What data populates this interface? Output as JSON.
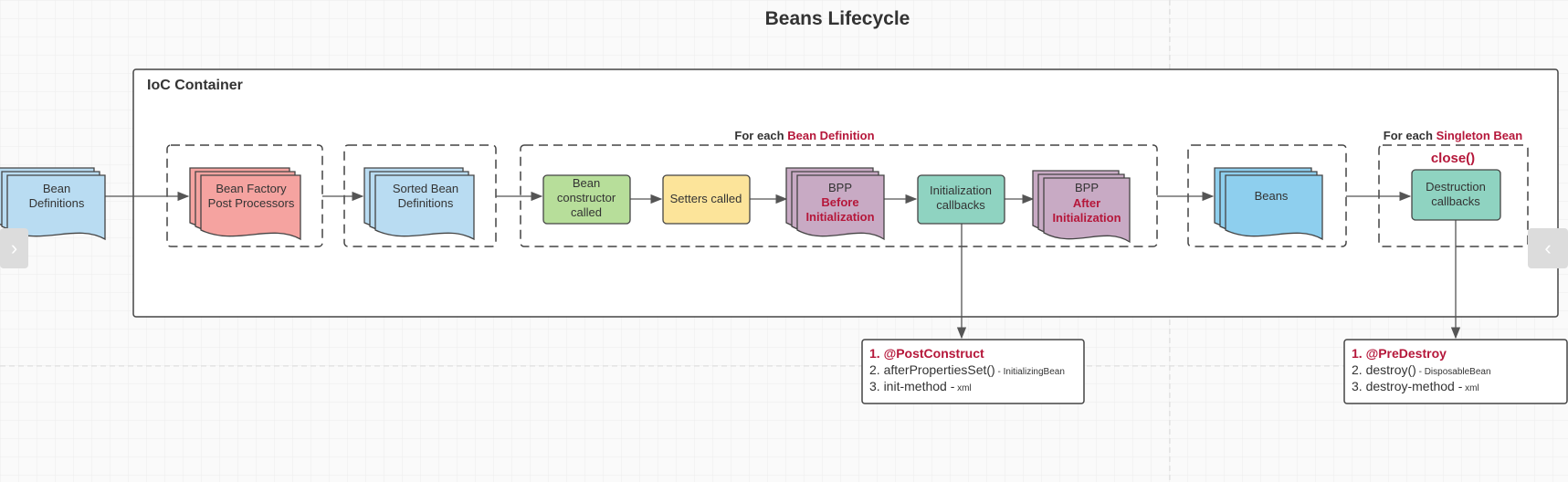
{
  "title": "Beans Lifecycle",
  "container": {
    "label": "IoC Container"
  },
  "colors": {
    "accent_red": "#b5173a",
    "bean_def_blue": "#b9dcf2",
    "bfpp_red": "#f5a3a0",
    "bpp_purple": "#c8aac4",
    "constructor_green": "#b7de9a",
    "setters_yellow": "#fce49a",
    "callbacks_teal": "#8fd3c1",
    "beans_blue": "#8ecfee"
  },
  "nodes": {
    "bean_definitions": [
      "Bean",
      "Definitions"
    ],
    "bfpp": [
      "Bean Factory",
      "Post Processors"
    ],
    "sorted": [
      "Sorted Bean",
      "Definitions"
    ],
    "constructor": [
      "Bean",
      "constructor",
      "called"
    ],
    "setters": "Setters called",
    "bpp_before": [
      "BPP",
      "Before",
      "Initialization"
    ],
    "init_callbacks": [
      "Initialization",
      "callbacks"
    ],
    "bpp_after": [
      "BPP",
      "After",
      "Initialization"
    ],
    "beans": "Beans",
    "destruction": [
      "Destruction",
      "callbacks"
    ]
  },
  "groups": {
    "for_each_def": {
      "prefix": "For each ",
      "highlight": "Bean Definition"
    },
    "for_each_singleton": {
      "prefix": "For each ",
      "highlight": "Singleton Bean",
      "sub": "close()"
    }
  },
  "init_list": {
    "item1": "1. @PostConstruct",
    "item2_main": "2. afterPropertiesSet()",
    "item2_note": " - InitializingBean",
    "item3_main": "3. init-method -",
    "item3_note": " xml"
  },
  "destroy_list": {
    "item1": "1. @PreDestroy",
    "item2_main": "2. destroy()",
    "item2_note": " - DisposableBean",
    "item3_main": "3. destroy-method -",
    "item3_note": " xml"
  },
  "nav": {
    "prev_icon": "chevron-right-icon",
    "next_icon": "chevron-left-icon",
    "prev": "›",
    "next": "‹"
  }
}
